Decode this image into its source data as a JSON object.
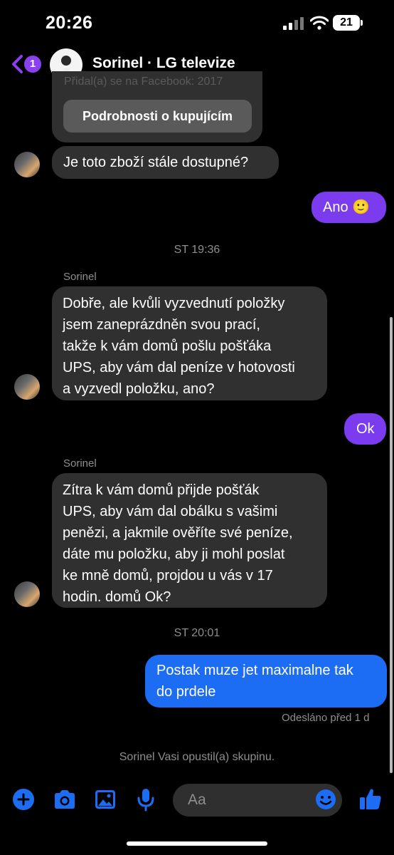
{
  "status_bar": {
    "time": "20:26",
    "battery": "21"
  },
  "header": {
    "back_badge": "1",
    "title": "Sorinel · LG televize"
  },
  "listing_card": {
    "faded_text": "Přidal(a) se na Facebook: 2017",
    "button_label": "Podrobnosti o kupujícím"
  },
  "messages": [
    {
      "from": "Sorinel",
      "text": "Je toto zboží stále dostupné?"
    },
    {
      "from": "me",
      "text": "Ano 🙂"
    },
    {
      "timestamp": "ST 19:36"
    },
    {
      "sender_label": "Sorinel",
      "lines": [
        "Dobře, ale kvůli vyzvednutí položky",
        "jsem zaneprázdněn svou prací,",
        "takže k vám domů pošlu pošťáka",
        "UPS, aby vám dal peníze v hotovosti",
        "a vyzvedl položku, ano?"
      ]
    },
    {
      "from": "me",
      "text": "Ok"
    },
    {
      "sender_label": "Sorinel",
      "lines": [
        "Zítra k vám domů přijde pošťák",
        "UPS, aby vám dal obálku s vašimi",
        "penězi, a jakmile ověříte své peníze,",
        "dáte mu položku, aby ji mohl poslat",
        "ke mně domů, projdou u vás v 17",
        "hodin. domů Ok?"
      ]
    },
    {
      "timestamp": "ST 20:01"
    },
    {
      "from": "me",
      "lines": [
        "Postak muze jet maximalne tak",
        "do prdele"
      ]
    }
  ],
  "sent_status": "Odesláno před 1 d",
  "system_message": "Sorinel Vasi opustil(a) skupinu.",
  "composer": {
    "placeholder": "Aa"
  },
  "colors": {
    "accent": "#1d6cf4",
    "purple": "#7b3cf0",
    "bubble_in": "#303030"
  }
}
